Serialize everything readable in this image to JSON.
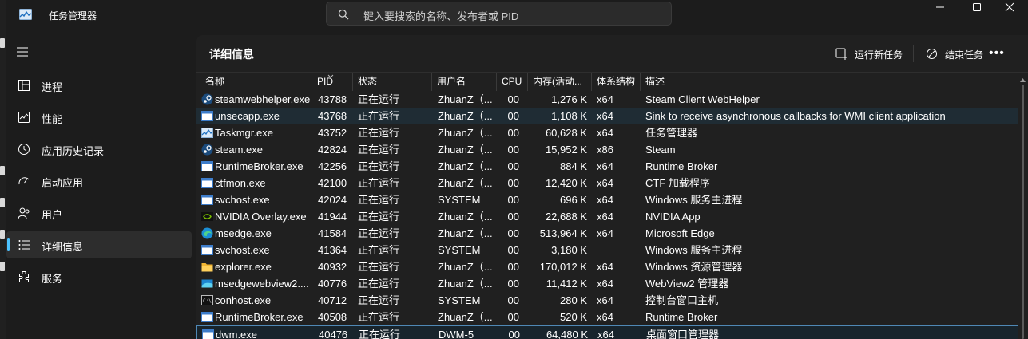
{
  "window": {
    "title": "任务管理器",
    "search_placeholder": "键入要搜索的名称、发布者或 PID"
  },
  "sidebar": {
    "items": [
      {
        "label": "进程",
        "icon": "processes-icon"
      },
      {
        "label": "性能",
        "icon": "performance-icon"
      },
      {
        "label": "应用历史记录",
        "icon": "app-history-icon"
      },
      {
        "label": "启动应用",
        "icon": "startup-apps-icon"
      },
      {
        "label": "用户",
        "icon": "users-icon"
      },
      {
        "label": "详细信息",
        "icon": "details-icon",
        "active": true
      },
      {
        "label": "服务",
        "icon": "services-icon"
      }
    ]
  },
  "page": {
    "title": "详细信息",
    "run_new_task": "运行新任务",
    "end_task": "结束任务",
    "more": "•••"
  },
  "table": {
    "headers": {
      "name": "名称",
      "pid": "PID",
      "status": "状态",
      "user": "用户名",
      "cpu": "CPU",
      "memory": "内存(活动...",
      "arch": "体系结构",
      "desc": "描述"
    },
    "rows": [
      {
        "icon": "steam",
        "name": "steamwebhelper.exe",
        "pid": "43788",
        "status": "正在运行",
        "user": "ZhuanZ（...",
        "cpu": "00",
        "memory": "1,276 K",
        "arch": "x64",
        "desc": "Steam Client WebHelper"
      },
      {
        "icon": "window",
        "name": "unsecapp.exe",
        "pid": "43768",
        "status": "正在运行",
        "user": "ZhuanZ（...",
        "cpu": "00",
        "memory": "1,108 K",
        "arch": "x64",
        "desc": "Sink to receive asynchronous callbacks for WMI client application"
      },
      {
        "icon": "taskmgr",
        "name": "Taskmgr.exe",
        "pid": "43752",
        "status": "正在运行",
        "user": "ZhuanZ（...",
        "cpu": "00",
        "memory": "60,628 K",
        "arch": "x64",
        "desc": "任务管理器"
      },
      {
        "icon": "steam",
        "name": "steam.exe",
        "pid": "42824",
        "status": "正在运行",
        "user": "ZhuanZ（...",
        "cpu": "00",
        "memory": "15,952 K",
        "arch": "x86",
        "desc": "Steam"
      },
      {
        "icon": "window",
        "name": "RuntimeBroker.exe",
        "pid": "42256",
        "status": "正在运行",
        "user": "ZhuanZ（...",
        "cpu": "00",
        "memory": "884 K",
        "arch": "x64",
        "desc": "Runtime Broker"
      },
      {
        "icon": "window",
        "name": "ctfmon.exe",
        "pid": "42100",
        "status": "正在运行",
        "user": "ZhuanZ（...",
        "cpu": "00",
        "memory": "12,420 K",
        "arch": "x64",
        "desc": "CTF 加载程序"
      },
      {
        "icon": "window",
        "name": "svchost.exe",
        "pid": "42024",
        "status": "正在运行",
        "user": "SYSTEM",
        "cpu": "00",
        "memory": "696 K",
        "arch": "x64",
        "desc": "Windows 服务主进程"
      },
      {
        "icon": "nvidia",
        "name": "NVIDIA Overlay.exe",
        "pid": "41944",
        "status": "正在运行",
        "user": "ZhuanZ（...",
        "cpu": "00",
        "memory": "22,688 K",
        "arch": "x64",
        "desc": "NVIDIA App"
      },
      {
        "icon": "edge",
        "name": "msedge.exe",
        "pid": "41584",
        "status": "正在运行",
        "user": "ZhuanZ（...",
        "cpu": "00",
        "memory": "513,964 K",
        "arch": "x64",
        "desc": "Microsoft Edge"
      },
      {
        "icon": "window",
        "name": "svchost.exe",
        "pid": "41364",
        "status": "正在运行",
        "user": "SYSTEM",
        "cpu": "00",
        "memory": "3,180 K",
        "arch": "",
        "desc": "Windows 服务主进程"
      },
      {
        "icon": "folder",
        "name": "explorer.exe",
        "pid": "40932",
        "status": "正在运行",
        "user": "ZhuanZ（...",
        "cpu": "00",
        "memory": "170,012 K",
        "arch": "x64",
        "desc": "Windows 资源管理器"
      },
      {
        "icon": "webview",
        "name": "msedgewebview2....",
        "pid": "40776",
        "status": "正在运行",
        "user": "ZhuanZ（...",
        "cpu": "00",
        "memory": "11,412 K",
        "arch": "x64",
        "desc": "WebView2 管理器"
      },
      {
        "icon": "console",
        "name": "conhost.exe",
        "pid": "40712",
        "status": "正在运行",
        "user": "SYSTEM",
        "cpu": "00",
        "memory": "280 K",
        "arch": "x64",
        "desc": "控制台窗口主机"
      },
      {
        "icon": "window",
        "name": "RuntimeBroker.exe",
        "pid": "40508",
        "status": "正在运行",
        "user": "ZhuanZ（...",
        "cpu": "00",
        "memory": "520 K",
        "arch": "x64",
        "desc": "Runtime Broker"
      },
      {
        "icon": "window",
        "name": "dwm.exe",
        "pid": "40476",
        "status": "正在运行",
        "user": "DWM-5",
        "cpu": "00",
        "memory": "64,480 K",
        "arch": "x64",
        "desc": "桌面窗口管理器"
      }
    ]
  },
  "colors": {
    "background": "#202020",
    "sidebar": "#1c1c1c",
    "accent": "#4cc2ff",
    "hover_row": "#1f2c34",
    "selected_border": "#4f88b5"
  }
}
